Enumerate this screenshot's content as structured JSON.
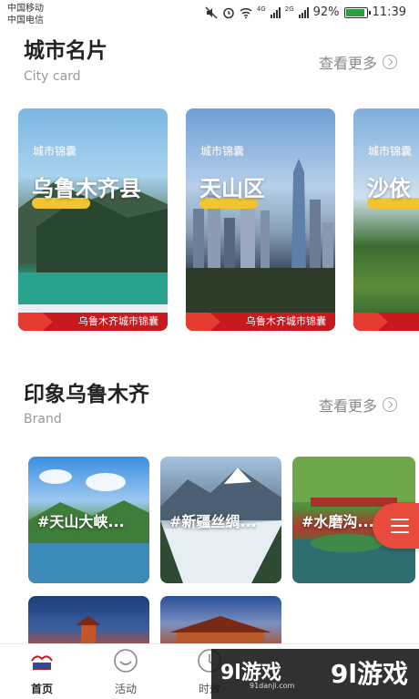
{
  "status_bar": {
    "carrier1": "中国移动",
    "carrier2": "中国电信",
    "network1": "4G",
    "network2": "2G",
    "battery": "92%",
    "battery_level": 0.92,
    "time": "11:39"
  },
  "city_section": {
    "title": "城市名片",
    "subtitle": "City card",
    "more": "查看更多",
    "cards": [
      {
        "badge": "城市锦囊",
        "name": "乌鲁木齐县",
        "ribbon": "乌鲁木齐城市锦囊"
      },
      {
        "badge": "城市锦囊",
        "name": "天山区",
        "ribbon": "乌鲁木齐城市锦囊"
      },
      {
        "badge": "城市锦囊",
        "name": "沙依",
        "ribbon": ""
      }
    ]
  },
  "brand_section": {
    "title": "印象乌鲁木齐",
    "subtitle": "Brand",
    "more": "查看更多",
    "tiles": [
      {
        "label": "#天山大峡..."
      },
      {
        "label": "#新疆丝绸..."
      },
      {
        "label": "#水磨沟..."
      },
      {
        "label": ""
      },
      {
        "label": ""
      }
    ]
  },
  "bottom_nav": {
    "items": [
      {
        "label": "首页",
        "icon": "home-logo-icon"
      },
      {
        "label": "活动",
        "icon": "smile-circle-icon"
      },
      {
        "label": "时效",
        "icon": "clock-icon"
      }
    ]
  },
  "watermark": {
    "mark": "9l游戏",
    "sub": "91danji.com",
    "big": "9l游戏"
  },
  "colors": {
    "ribbon_red": "#c8191f",
    "tag_yellow": "#f2c431",
    "fab_red": "#e84b3c"
  }
}
